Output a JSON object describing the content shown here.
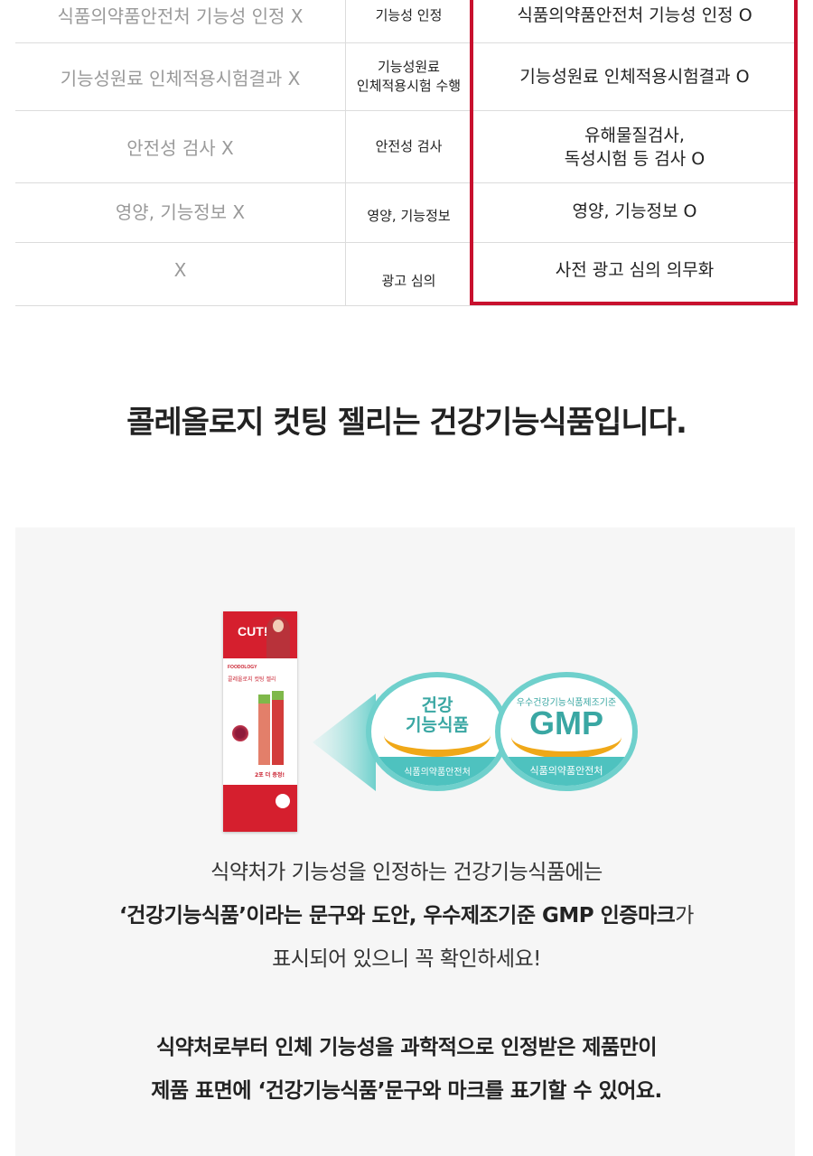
{
  "comparison": {
    "rows": [
      {
        "general": "식품의약품안전처 기능성 인정 X",
        "item": "기능성 인정",
        "health": "식품의약품안전처 기능성 인정 O"
      },
      {
        "general": "기능성원료 인체적용시험결과 X",
        "item_line1": "기능성원료",
        "item_line2": "인체적용시험 수행",
        "health": "기능성원료 인체적용시험결과 O"
      },
      {
        "general": "안전성 검사 X",
        "item": "안전성 검사",
        "health_line1": "유해물질검사,",
        "health_line2": "독성시험 등 검사 O"
      },
      {
        "general": "영양, 기능정보 X",
        "item": "영양, 기능정보",
        "health": "영양, 기능정보 O"
      },
      {
        "general": "X",
        "item": "광고 심의",
        "health": "사전 광고 심의 의무화"
      }
    ],
    "highlight_color": "#c8102e"
  },
  "headline": "콜레올로지 컷팅 젤리는 건강기능식품입니다.",
  "product": {
    "cut_label": "CUT!",
    "brand": "FOODOLOGY",
    "name": "콜레올로지 컷팅 젤리",
    "bonus": "2포 더 증정!"
  },
  "badges": {
    "health_food": {
      "line1": "건강",
      "line2": "기능식품",
      "footer": "식품의약품안전처"
    },
    "gmp": {
      "subtitle": "우수건강기능식품제조기준",
      "mark": "GMP",
      "footer": "식품의약품안전처"
    },
    "teal": "#4ec2bf",
    "arc_color": "#f0a818"
  },
  "description": {
    "line1": "식약처가 기능성을 인정하는 건강기능식품에는",
    "line2_bold": "‘건강기능식품’이라는 문구와 도안, 우수제조기준 GMP 인증마크",
    "line2_tail": "가",
    "line3": "표시되어 있으니 꼭 확인하세요!",
    "line4": "식약처로부터 인체 기능성을 과학적으로 인정받은 제품만이",
    "line5": "제품 표면에 ‘건강기능식품’문구와 마크를 표기할 수 있어요."
  }
}
